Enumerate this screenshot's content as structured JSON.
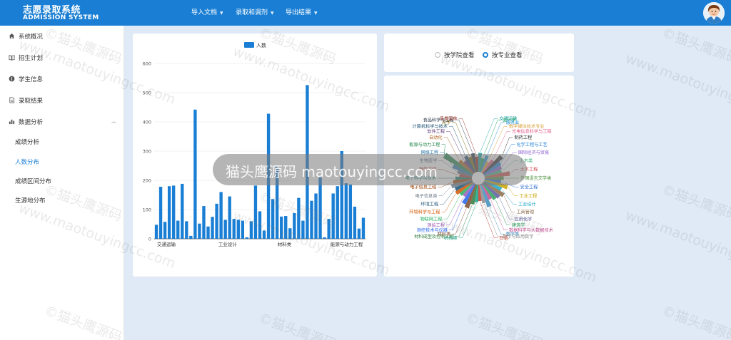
{
  "app": {
    "title_cn": "志愿录取系统",
    "title_en": "ADMISSION SYSTEM"
  },
  "nav": [
    {
      "label": "导入文档"
    },
    {
      "label": "录取和调剂"
    },
    {
      "label": "导出结果"
    }
  ],
  "sidebar": {
    "items": [
      {
        "label": "系统概况"
      },
      {
        "label": "招生计划"
      },
      {
        "label": "学生信息"
      },
      {
        "label": "录取结果"
      },
      {
        "label": "数据分析"
      }
    ],
    "sub_items": [
      {
        "label": "成绩分析"
      },
      {
        "label": "人数分布"
      },
      {
        "label": "成绩区间分布"
      },
      {
        "label": "生源地分布"
      }
    ]
  },
  "view_toggle": {
    "options": [
      {
        "label": "按学院查看",
        "checked": false
      },
      {
        "label": "按专业查看",
        "checked": true
      }
    ]
  },
  "watermark": {
    "text": "©猫头鹰源码",
    "url": "www.maotouyingcc.com",
    "band_text": "猫头鹰源码 maotouyingcc.com"
  },
  "chart_data": [
    {
      "type": "bar",
      "legend": [
        "人数"
      ],
      "ylim": [
        0,
        600
      ],
      "yticks": [
        0,
        100,
        200,
        300,
        400,
        500,
        600
      ],
      "tick_labels": [
        "交通运输",
        "工业设计",
        "材料类",
        "能源与动力工程"
      ],
      "values": [
        48,
        178,
        58,
        180,
        182,
        62,
        188,
        60,
        10,
        442,
        52,
        112,
        42,
        75,
        120,
        160,
        65,
        145,
        68,
        65,
        62,
        5,
        60,
        182,
        94,
        28,
        428,
        136,
        246,
        76,
        78,
        36,
        88,
        140,
        62,
        526,
        130,
        155,
        210,
        5,
        68,
        155,
        180,
        300,
        190,
        186,
        110,
        35,
        72
      ],
      "colors": {
        "bar": "#1a7fd4",
        "grid": "#e4e4e4",
        "axis": "#333333"
      }
    },
    {
      "type": "pie",
      "variant": "rose",
      "labels": [
        "交通运输",
        "会计学",
        "服务业",
        "数字媒体技术专业",
        "光电信息科学与工程",
        "制药工程",
        "化学工程与工艺",
        "国际经济与贸易",
        "土木类",
        "土木工程",
        "外国语言文学类",
        "安全工程",
        "工业工程",
        "工业设计",
        "工商管理",
        "应用化学",
        "建筑学",
        "数据科学与大数据技术",
        "数学类",
        "数学与应用数学",
        "日语",
        "机械类",
        "材料成型及控制工程",
        "材料类",
        "测控技术与仪器",
        "测绘工程",
        "物联网工程",
        "环境科学与工程",
        "环境工程",
        "电子信息类",
        "电子信息工程",
        "电子科学与技术",
        "电气工程",
        "生物医学",
        "网络工程",
        "能源与动力工程",
        "自动化",
        "软件工程",
        "计算机科学与技术",
        "光学",
        "食品科学与工程",
        "风景园林"
      ],
      "colors": [
        "#1aa2a2",
        "#18a058",
        "#1f8fd6",
        "#d9a13b",
        "#e05c8a",
        "#2d2d2d",
        "#1a7fd4",
        "#8a5ccf",
        "#3fb27f",
        "#d04b4b",
        "#4a8f3a",
        "#2a6bd1",
        "#c9a300",
        "#1ba3c6",
        "#8b6b4a",
        "#5b5b9a",
        "#2aa05c",
        "#c04b8f",
        "#3c8dbc",
        "#8c8c8c",
        "#c0392b",
        "#16a085",
        "#2c7a3a",
        "#7a4a2c",
        "#2563eb",
        "#9b59b6",
        "#27ae60",
        "#d35400",
        "#1a5276",
        "#6c7a89",
        "#a04000",
        "#117864",
        "#b03a2e",
        "#5d6d7e",
        "#2874a6",
        "#1e8449",
        "#af601a",
        "#633974",
        "#1b4f72",
        "#7d6608",
        "#283747",
        "#922b21"
      ],
      "values": [
        30,
        22,
        28,
        20,
        26,
        40,
        32,
        30,
        28,
        40,
        30,
        26,
        38,
        30,
        38,
        34,
        32,
        28,
        38,
        30,
        26,
        28,
        32,
        40,
        36,
        26,
        28,
        32,
        30,
        34,
        30,
        26,
        20,
        24,
        34,
        54,
        30,
        24,
        30,
        26,
        30,
        24
      ]
    }
  ]
}
